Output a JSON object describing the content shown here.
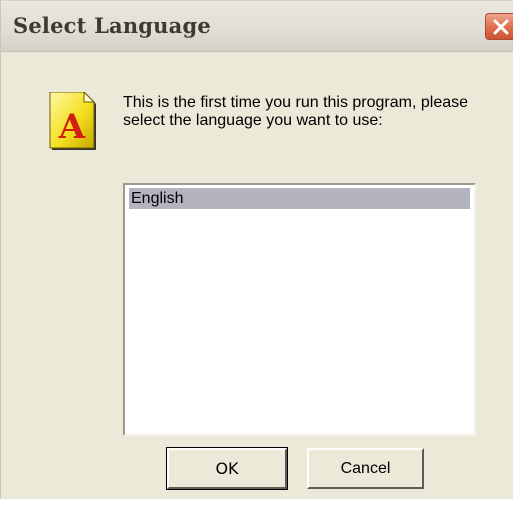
{
  "window": {
    "title": "Select Language"
  },
  "title_bar": {
    "close_icon": "close-x-icon"
  },
  "dialog": {
    "icon": "font-a-document-icon",
    "message": "This is the first time you run this program, please select the language you want to use:"
  },
  "language_list": {
    "items": [
      "English"
    ],
    "selected": "English"
  },
  "buttons": {
    "ok_label": "OK",
    "cancel_label": "Cancel"
  },
  "colors": {
    "dialog_bg": "#ece9d8",
    "selection_bg": "#b4b3c0",
    "close_button": "#e0704e"
  }
}
